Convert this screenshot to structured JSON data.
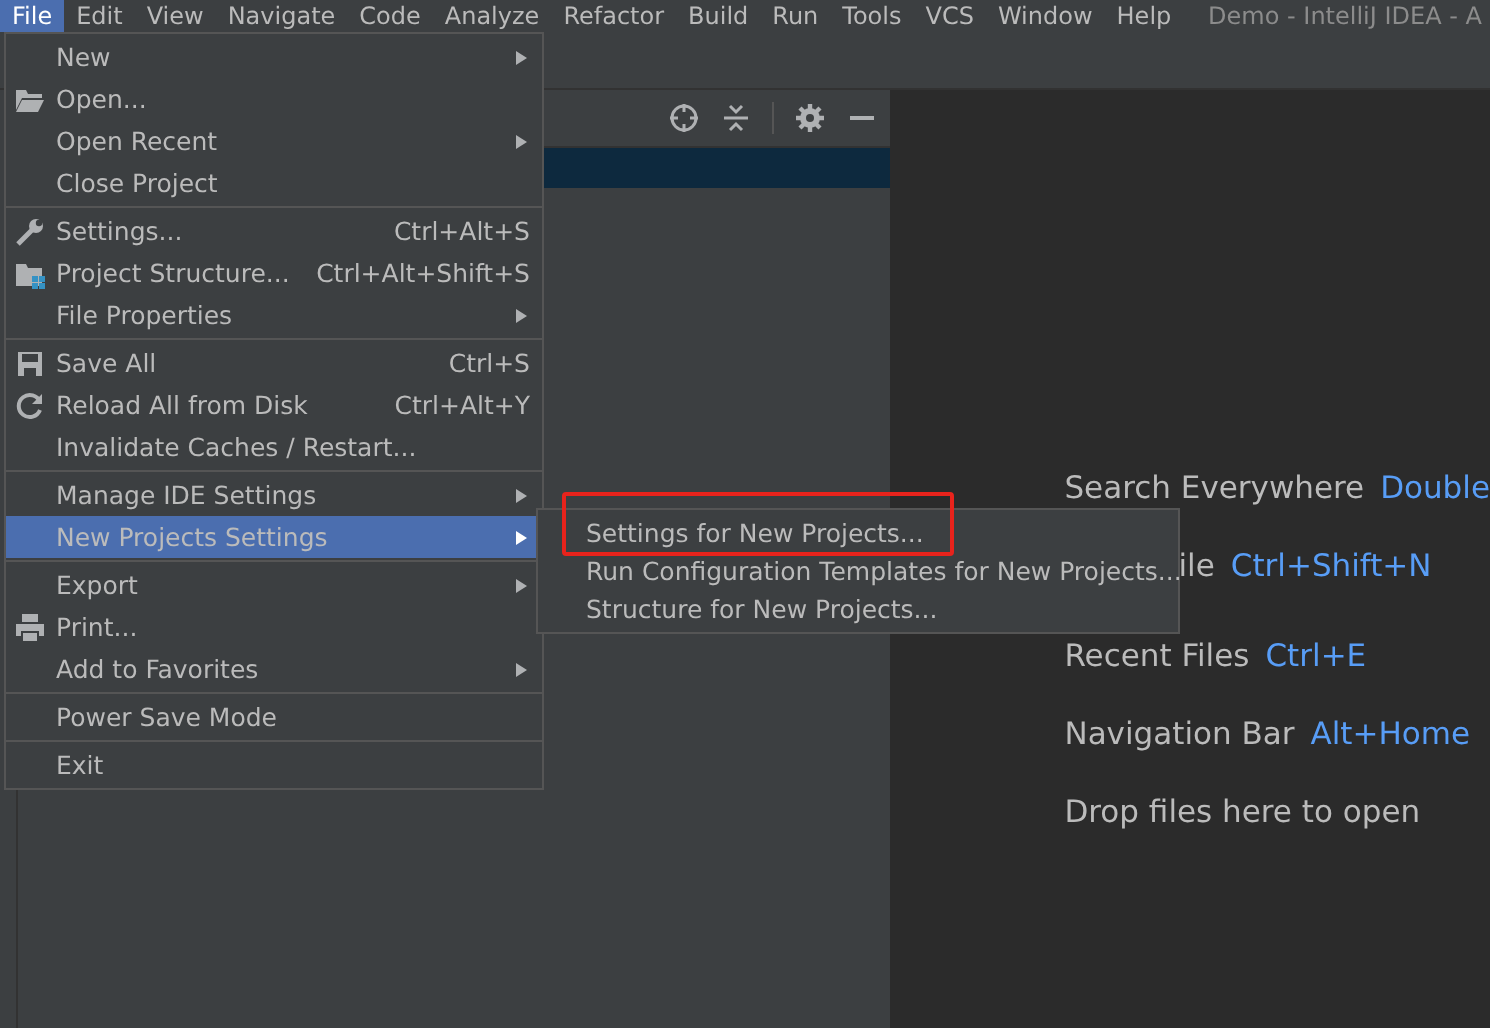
{
  "menubar": {
    "items": [
      {
        "label": "File",
        "selected": true
      },
      {
        "label": "Edit",
        "selected": false
      },
      {
        "label": "View",
        "selected": false
      },
      {
        "label": "Navigate",
        "selected": false
      },
      {
        "label": "Code",
        "selected": false
      },
      {
        "label": "Analyze",
        "selected": false
      },
      {
        "label": "Refactor",
        "selected": false
      },
      {
        "label": "Build",
        "selected": false
      },
      {
        "label": "Run",
        "selected": false
      },
      {
        "label": "Tools",
        "selected": false
      },
      {
        "label": "VCS",
        "selected": false
      },
      {
        "label": "Window",
        "selected": false
      },
      {
        "label": "Help",
        "selected": false
      }
    ],
    "title": "Demo - IntelliJ IDEA - A"
  },
  "file_menu": {
    "groups": [
      [
        {
          "label": "New",
          "submenu": true,
          "selected": false
        },
        {
          "label": "Open...",
          "submenu": false,
          "selected": false
        },
        {
          "label": "Open Recent",
          "submenu": true,
          "selected": false
        },
        {
          "label": "Close Project",
          "submenu": false,
          "selected": false
        }
      ],
      [
        {
          "label": "Settings...",
          "shortcut": "Ctrl+Alt+S",
          "submenu": false,
          "selected": false
        },
        {
          "label": "Project Structure...",
          "shortcut": "Ctrl+Alt+Shift+S",
          "submenu": false,
          "selected": false
        },
        {
          "label": "File Properties",
          "submenu": true,
          "selected": false
        }
      ],
      [
        {
          "label": "Save All",
          "shortcut": "Ctrl+S",
          "submenu": false,
          "selected": false
        },
        {
          "label": "Reload All from Disk",
          "shortcut": "Ctrl+Alt+Y",
          "submenu": false,
          "selected": false
        },
        {
          "label": "Invalidate Caches / Restart...",
          "submenu": false,
          "selected": false
        }
      ],
      [
        {
          "label": "Manage IDE Settings",
          "submenu": true,
          "selected": false
        },
        {
          "label": "New Projects Settings",
          "submenu": true,
          "selected": true
        }
      ],
      [
        {
          "label": "Export",
          "submenu": true,
          "selected": false
        },
        {
          "label": "Print...",
          "submenu": false,
          "selected": false
        },
        {
          "label": "Add to Favorites",
          "submenu": true,
          "selected": false
        }
      ],
      [
        {
          "label": "Power Save Mode",
          "submenu": false,
          "selected": false
        }
      ],
      [
        {
          "label": "Exit",
          "submenu": false,
          "selected": false
        }
      ]
    ]
  },
  "submenu": {
    "items": [
      {
        "label": "Settings for New Projects...",
        "highlighted": true
      },
      {
        "label": "Run Configuration Templates for New Projects...",
        "highlighted": false
      },
      {
        "label": "Structure for New Projects...",
        "highlighted": false
      }
    ]
  },
  "editor_hints": [
    {
      "label": "Search Everywhere",
      "key": "Double"
    },
    {
      "label": "ile",
      "key": "Ctrl+Shift+N"
    },
    {
      "label": "Recent Files",
      "key": "Ctrl+E"
    },
    {
      "label": "Navigation Bar",
      "key": "Alt+Home"
    },
    {
      "label": "Drop files here to open"
    }
  ]
}
